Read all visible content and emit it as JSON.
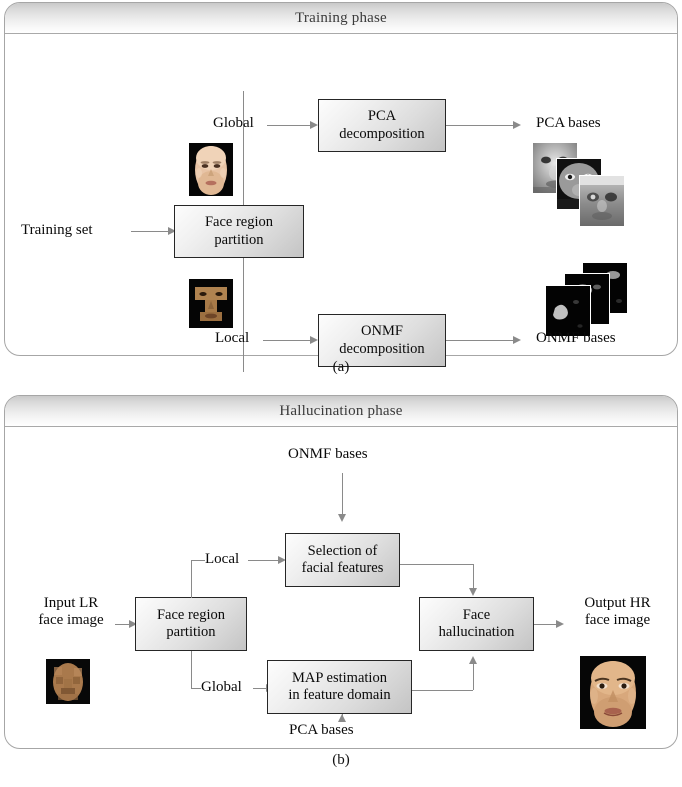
{
  "figure": {
    "panels": [
      {
        "id": "a",
        "title": "Training phase",
        "caption": "(a)",
        "nodes": [
          {
            "id": "face-region-partition",
            "label": "Face region\npartition"
          },
          {
            "id": "pca-decomposition",
            "label": "PCA\ndecomposition"
          },
          {
            "id": "onmf-decomposition",
            "label": "ONMF\ndecomposition"
          }
        ],
        "labels": [
          {
            "id": "training-set",
            "text": "Training set"
          },
          {
            "id": "global-branch",
            "text": "Global"
          },
          {
            "id": "local-branch",
            "text": "Local"
          },
          {
            "id": "pca-bases",
            "text": "PCA bases"
          },
          {
            "id": "onmf-bases",
            "text": "ONMF bases"
          }
        ],
        "thumbnails": [
          {
            "id": "global-face-thumb",
            "kind": "color-face"
          },
          {
            "id": "local-face-thumb",
            "kind": "t-shape-face-region"
          },
          {
            "id": "pca-bases-stack",
            "kind": "grayscale-eigenface-stack",
            "count": 3
          },
          {
            "id": "onmf-bases-stack",
            "kind": "sparse-dark-basis-stack",
            "count": 3
          }
        ]
      },
      {
        "id": "b",
        "title": "Hallucination phase",
        "caption": "(b)",
        "nodes": [
          {
            "id": "face-region-partition",
            "label": "Face region\npartition"
          },
          {
            "id": "selection-of-facial-features",
            "label": "Selection of\nfacial features"
          },
          {
            "id": "map-estimation",
            "label": "MAP estimation\nin feature domain"
          },
          {
            "id": "face-hallucination",
            "label": "Face\nhallucination"
          }
        ],
        "labels": [
          {
            "id": "onmf-bases-input",
            "text": "ONMF bases"
          },
          {
            "id": "pca-bases-input",
            "text": "PCA bases"
          },
          {
            "id": "input-lr",
            "text": "Input LR\nface image"
          },
          {
            "id": "output-hr",
            "text": "Output HR\nface image"
          },
          {
            "id": "local-branch",
            "text": "Local"
          },
          {
            "id": "global-branch",
            "text": "Global"
          }
        ],
        "thumbnails": [
          {
            "id": "input-lr-face-thumb",
            "kind": "blurry-lowres-face"
          },
          {
            "id": "output-hr-face-thumb",
            "kind": "sharp-highres-face"
          }
        ]
      }
    ]
  },
  "text": {
    "panel_a_title": "Training phase",
    "panel_a_caption": "(a)",
    "panel_b_title": "Hallucination phase",
    "panel_b_caption": "(b)",
    "training_set": "Training set",
    "global": "Global",
    "local": "Local",
    "face_region_partition_l1": "Face region",
    "face_region_partition_l2": "partition",
    "pca_decomposition_l1": "PCA",
    "pca_decomposition_l2": "decomposition",
    "onmf_decomposition_l1": "ONMF",
    "onmf_decomposition_l2": "decomposition",
    "pca_bases": "PCA bases",
    "onmf_bases": "ONMF bases",
    "selection_l1": "Selection of",
    "selection_l2": "facial features",
    "map_l1": "MAP estimation",
    "map_l2": "in feature domain",
    "hallucination_l1": "Face",
    "hallucination_l2": "hallucination",
    "input_lr_l1": "Input LR",
    "input_lr_l2": "face image",
    "output_hr_l1": "Output HR",
    "output_hr_l2": "face image"
  },
  "colors": {
    "panel_border": "#a6a6a6",
    "box_border": "#262626",
    "connector": "#8a8a8a",
    "title_text": "#3a3a3a",
    "body_text": "#0a0a0a",
    "thumb_background": "#000000"
  }
}
